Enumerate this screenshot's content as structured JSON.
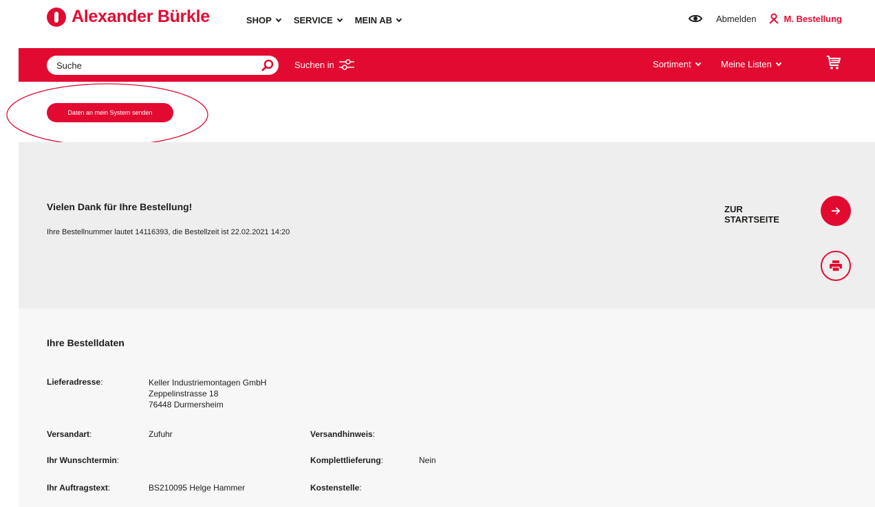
{
  "brand": {
    "name": "Alexander Bürkle",
    "color": "#e30a32"
  },
  "nav": {
    "menu": [
      "SHOP",
      "SERVICE",
      "MEIN AB"
    ],
    "logout": "Abmelden",
    "order": "M. Bestellung"
  },
  "searchbar": {
    "placeholder": "Suche",
    "search_in": "Suchen in",
    "sortiment": "Sortiment",
    "meine_listen": "Meine Listen"
  },
  "send_button": "Daten an mein System senden",
  "thanks": {
    "title": "Vielen Dank für Ihre Bestellung!",
    "text": "Ihre Bestellnummer lautet 14116393, die Bestellzeit ist 22.02.2021 14:20",
    "home_line1": "ZUR",
    "home_line2": "STARTSEITE"
  },
  "order_data": {
    "title": "Ihre Bestelldaten",
    "labels": {
      "lieferadresse": "Lieferadresse",
      "versandart": "Versandart",
      "wunschtermin": "Ihr Wunschtermin",
      "auftragstext": "Ihr Auftragstext",
      "versandhinweis": "Versandhinweis",
      "komplettlieferung": "Komplettlieferung",
      "kostenstelle": "Kostenstelle"
    },
    "address": [
      "Keller Industriemontagen GmbH",
      "Zeppelinstrasse 18",
      "76448 Durmersheim"
    ],
    "versandart": "Zufuhr",
    "auftragstext": "BS210095 Helge Hammer",
    "komplettlieferung": "Nein"
  }
}
